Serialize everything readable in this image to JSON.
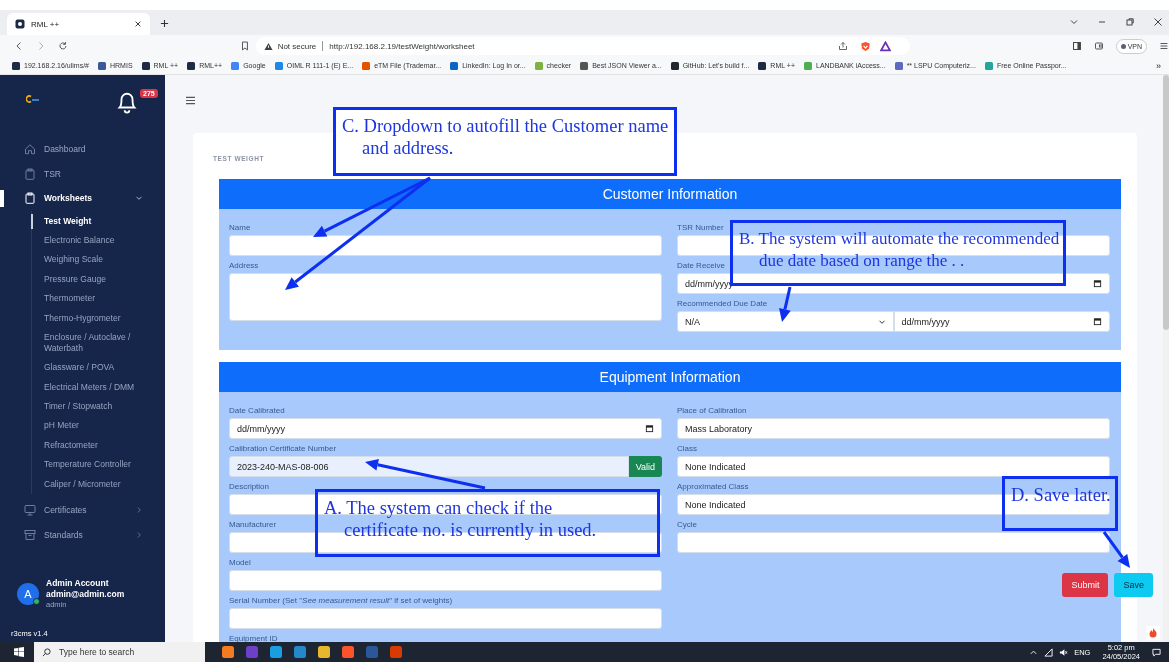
{
  "browser": {
    "tab_title": "RML ++",
    "security": "Not secure",
    "url": "http://192.168.2.19/testWeight/worksheet",
    "vpn": "VPN",
    "bookmarks": [
      {
        "label": "192.168.2.16/ulims/#",
        "color": "#1f2a44"
      },
      {
        "label": "HRMIS",
        "color": "#3b5998"
      },
      {
        "label": "RML ++",
        "color": "#1f2a44"
      },
      {
        "label": "RML++",
        "color": "#1f2a44"
      },
      {
        "label": "Google",
        "color": "#4285f4"
      },
      {
        "label": "OIML R 111-1 (E) E...",
        "color": "#1e88e5"
      },
      {
        "label": "eTM File (Trademar...",
        "color": "#e65100"
      },
      {
        "label": "LinkedIn: Log In or...",
        "color": "#0a66c2"
      },
      {
        "label": "checker",
        "color": "#7cb342"
      },
      {
        "label": "Best JSON Viewer a...",
        "color": "#555555"
      },
      {
        "label": "GitHub: Let's build f...",
        "color": "#24292f"
      },
      {
        "label": "RML ++",
        "color": "#1f2a44"
      },
      {
        "label": "LANDBANK iAccess...",
        "color": "#4caf50"
      },
      {
        "label": "** LSPU Computeriz...",
        "color": "#5c6bc0"
      },
      {
        "label": "Free Online Passpor...",
        "color": "#26a69a"
      }
    ],
    "bookmarks_more": "»"
  },
  "sidebar": {
    "notifications": "275",
    "nav": [
      {
        "label": "Dashboard",
        "kind": "link",
        "selected": false
      },
      {
        "label": "TSR",
        "kind": "link",
        "selected": false
      },
      {
        "label": "Worksheets",
        "kind": "group",
        "expanded": true,
        "selected": true,
        "children": [
          {
            "label": "Test Weight",
            "selected": true
          },
          {
            "label": "Electronic Balance",
            "selected": false
          },
          {
            "label": "Weighing Scale",
            "selected": false
          },
          {
            "label": "Pressure Gauge",
            "selected": false
          },
          {
            "label": "Thermometer",
            "selected": false
          },
          {
            "label": "Thermo-Hygrometer",
            "selected": false
          },
          {
            "label": "Enclosure / Autoclave / Waterbath",
            "selected": false
          },
          {
            "label": "Glassware / POVA",
            "selected": false
          },
          {
            "label": "Electrical Meters / DMM",
            "selected": false
          },
          {
            "label": "Timer / Stopwatch",
            "selected": false
          },
          {
            "label": "pH Meter",
            "selected": false
          },
          {
            "label": "Refractometer",
            "selected": false
          },
          {
            "label": "Temperature Controller",
            "selected": false
          },
          {
            "label": "Caliper / Micrometer",
            "selected": false
          }
        ]
      },
      {
        "label": "Certificates",
        "kind": "group",
        "expanded": false,
        "selected": false
      },
      {
        "label": "Standards",
        "kind": "group",
        "expanded": false,
        "selected": false
      }
    ],
    "user": {
      "initial": "A",
      "name": "Admin Account",
      "email": "admin@admin.com",
      "role": "admin",
      "online": true
    },
    "version": "r3cms v1.4"
  },
  "page": {
    "section": "TEST WEIGHT",
    "panels": [
      {
        "title": "Customer Information",
        "left": [
          {
            "label": "Name",
            "kind": "text"
          },
          {
            "label": "Address",
            "kind": "textarea"
          }
        ],
        "right": [
          {
            "label": "TSR Number",
            "kind": "text"
          },
          {
            "label": "Date Receive",
            "kind": "date",
            "value": "dd/mm/yyyy"
          },
          {
            "label": "Recommended Due Date",
            "kind": "select_date",
            "value": "N/A",
            "date": "dd/mm/yyyy"
          }
        ]
      },
      {
        "title": "Equipment Information",
        "left": [
          {
            "label": "Date Calibrated",
            "kind": "date",
            "value": "dd/mm/yyyy"
          },
          {
            "label": "Calibration Certificate Number",
            "kind": "validated",
            "value": "2023-240-MAS-08-006",
            "badge": "Valid"
          },
          {
            "label": "Description",
            "kind": "text"
          },
          {
            "label": "Manufacturer",
            "kind": "text"
          },
          {
            "label": "Model",
            "kind": "text"
          },
          {
            "label": "Serial Number (Set \"*See measurement result*\" if set of weights)",
            "kind": "text"
          },
          {
            "label": "Equipment ID",
            "kind": "cut"
          }
        ],
        "right": [
          {
            "label": "Place of Calibration",
            "kind": "text",
            "value": "Mass Laboratory"
          },
          {
            "label": "Class",
            "kind": "text",
            "value": "None Indicated"
          },
          {
            "label": "Approximated Class",
            "kind": "text",
            "value": "None Indicated"
          },
          {
            "label": "Cycle",
            "kind": "text"
          }
        ]
      }
    ],
    "buttons": [
      {
        "label": "Submit",
        "kind": "danger"
      },
      {
        "label": "Save",
        "kind": "info"
      }
    ]
  },
  "annotations": [
    {
      "text": "C. Dropdown to autofill the Customer name and address."
    },
    {
      "text": "B. The system will automate the recommended due date based on range the . ."
    },
    {
      "text": "A. The system can check if the certificate no. is currently in used."
    },
    {
      "text": "D. Save later."
    }
  ],
  "taskbar": {
    "search_placeholder": "Type here to search",
    "apps": [
      {
        "color": "#f47b20"
      },
      {
        "color": "#6e40c9"
      },
      {
        "color": "#1b9de2"
      },
      {
        "color": "#2489ca"
      },
      {
        "color": "#e8b730"
      },
      {
        "color": "#fb542b"
      },
      {
        "color": "#2b579a"
      },
      {
        "color": "#d83b01"
      }
    ],
    "language": "ENG",
    "time": "5:02 pm",
    "date": "24/05/2024"
  }
}
